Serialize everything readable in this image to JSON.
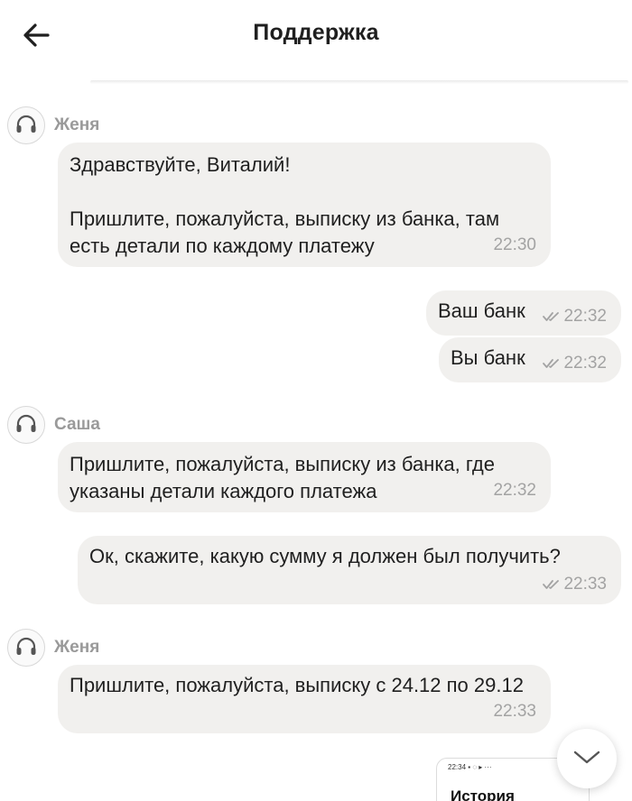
{
  "header": {
    "title": "Поддержка"
  },
  "messages": [
    {
      "author": "Женя",
      "text": "Здравствуйте, Виталий!\n\nПришлите, пожалуйста, выписку из банка, там есть детали по каждому платежу",
      "time": "22:30"
    },
    {
      "text": "Ваш банк",
      "time": "22:32"
    },
    {
      "text": "Вы банк",
      "time": "22:32"
    },
    {
      "author": "Саша",
      "text": "Пришлите, пожалуйста, выписку из банка, где указаны детали каждого платежа",
      "time": "22:32"
    },
    {
      "text": "Ок, скажите, какую сумму я должен был получить?",
      "time": "22:33"
    },
    {
      "author": "Женя",
      "text": "Пришлите, пожалуйста, выписку с 24.12 по 29.12",
      "time": "22:33"
    }
  ],
  "attachment": {
    "status_time": "22:34",
    "title": "История"
  },
  "icons": {
    "back": "arrow-left-icon",
    "avatar": "headset-icon",
    "read": "double-check-icon",
    "scroll": "chevron-down-icon"
  },
  "colors": {
    "bubble": "#f1f0ee",
    "muted": "#a3a3a3",
    "text": "#1f1f1f"
  }
}
